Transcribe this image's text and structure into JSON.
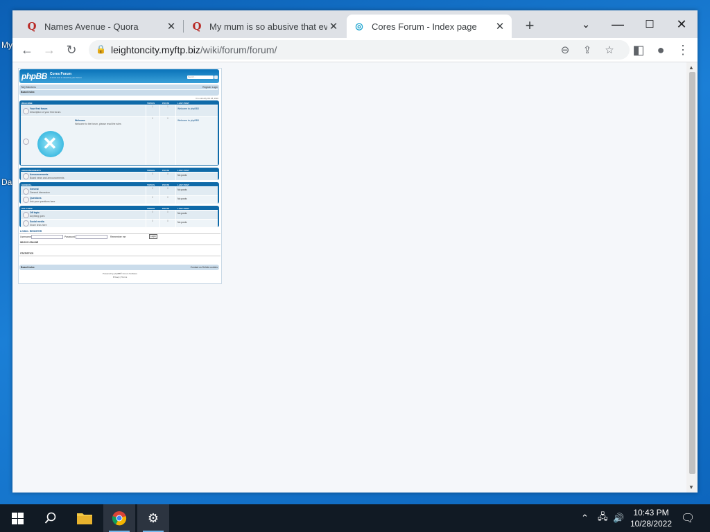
{
  "desktop": {
    "icon_labels": [
      "My",
      "Da"
    ]
  },
  "browser": {
    "tabs": [
      {
        "title": "Names Avenue - Quora",
        "favicon": "quora-icon",
        "active": false
      },
      {
        "title": "My mum is so abusive that even",
        "favicon": "quora-icon",
        "active": false
      },
      {
        "title": "Cores Forum - Index page",
        "favicon": "globe-icon",
        "active": true
      }
    ],
    "new_tab_label": "+",
    "url_host": "leightoncity.myftp.biz",
    "url_path": "/wiki/forum/forum/"
  },
  "forum": {
    "logo": "phpBB",
    "site_title": "Cores Forum",
    "site_desc": "A short text to describe your forum",
    "search_placeholder": "Search…",
    "nav_left": "FAQ  Members",
    "nav_right": "Register  Login",
    "nav_board_index": "Board index",
    "time_info": "It is currently Oct 28, 2022",
    "categories": [
      {
        "name": "WELCOME",
        "col_topics": "TOPICS",
        "col_posts": "POSTS",
        "col_last": "LAST POST",
        "rows": [
          {
            "title": "Your first forum",
            "desc": "Description of your first forum.",
            "topics": "1",
            "posts": "1",
            "last": "Welcome to phpBB3"
          },
          {
            "title": "Welcome",
            "desc": "Welcome to the forum, please read the rules",
            "topics": "0",
            "posts": "0",
            "last": "Welcome to phpBB3"
          }
        ]
      },
      {
        "name": "ANNOUNCEMENTS",
        "col_topics": "TOPICS",
        "col_posts": "POSTS",
        "col_last": "LAST POST",
        "rows": [
          {
            "title": "Announcements",
            "desc": "Board news and announcements",
            "topics": "0",
            "posts": "0",
            "last": "No posts"
          }
        ]
      },
      {
        "name": "GENERAL",
        "col_topics": "TOPICS",
        "col_posts": "POSTS",
        "col_last": "LAST POST",
        "rows": [
          {
            "title": "General",
            "desc": "General discussion",
            "topics": "0",
            "posts": "0",
            "last": "No posts"
          },
          {
            "title": "Questions",
            "desc": "Ask your questions here",
            "topics": "0",
            "posts": "0",
            "last": "No posts"
          }
        ]
      },
      {
        "name": "OFF TOPIC",
        "col_topics": "TOPICS",
        "col_posts": "POSTS",
        "col_last": "LAST POST",
        "rows": [
          {
            "title": "Off topic",
            "desc": "Anything goes",
            "topics": "0",
            "posts": "0",
            "last": "No posts"
          },
          {
            "title": "Social media",
            "desc": "Share links here",
            "topics": "0",
            "posts": "0",
            "last": "No posts"
          }
        ]
      }
    ],
    "login_title": "LOGIN  •  REGISTER",
    "username_label": "Username:",
    "password_label": "Password:",
    "remember_label": "Remember me",
    "login_button": "Login",
    "who_online": "WHO IS ONLINE",
    "statistics": "STATISTICS",
    "footer_board_index": "Board index",
    "footer_right": "Contact us  Delete cookies",
    "copyright": "Powered by phpBB® Forum Software",
    "privacy": "Privacy | Terms"
  },
  "taskbar": {
    "time": "10:43 PM",
    "date": "10/28/2022"
  }
}
